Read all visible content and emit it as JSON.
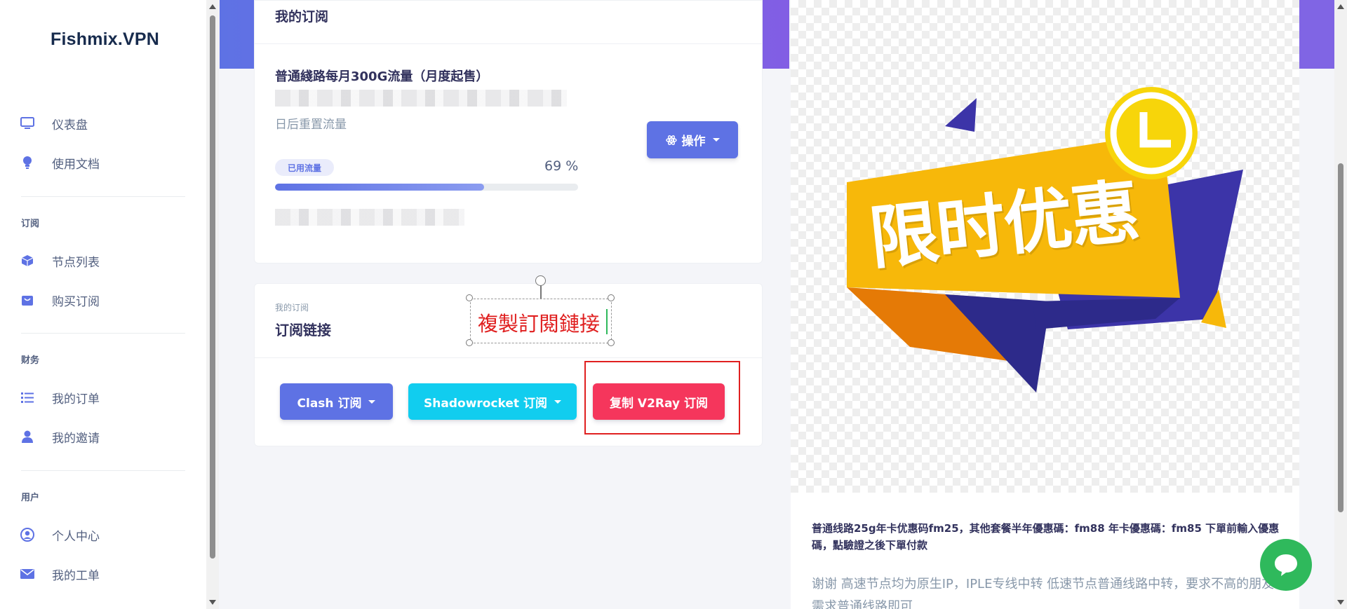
{
  "app": {
    "brand": "Fishmix.VPN"
  },
  "sidebar": {
    "items": [
      {
        "label": "仪表盘",
        "icon": "monitor-icon"
      },
      {
        "label": "使用文档",
        "icon": "lightbulb-icon"
      }
    ],
    "sections": [
      {
        "heading": "订阅",
        "items": [
          {
            "label": "节点列表",
            "icon": "cube-icon"
          },
          {
            "label": "购买订阅",
            "icon": "shopping-bag-icon"
          }
        ]
      },
      {
        "heading": "财务",
        "items": [
          {
            "label": "我的订单",
            "icon": "list-icon"
          },
          {
            "label": "我的邀请",
            "icon": "user-icon"
          }
        ]
      },
      {
        "heading": "用户",
        "items": [
          {
            "label": "个人中心",
            "icon": "user-circle-icon"
          },
          {
            "label": "我的工单",
            "icon": "envelope-icon"
          }
        ]
      }
    ]
  },
  "subscription_card": {
    "title": "我的订阅",
    "plan_name": "普通綫路每月300G流量（月度起售）",
    "reset_note": "日后重置流量",
    "usage_badge": "已用流量",
    "usage_percent_text": "69 %",
    "usage_percent": 0.69,
    "action_button": "操作"
  },
  "link_card": {
    "subtitle": "我的订阅",
    "title": "订阅链接",
    "annotation_text": "複製訂閱鏈接",
    "buttons": {
      "clash": "Clash 订阅",
      "shadowrocket": "Shadowrocket 订阅",
      "v2ray": "复制 V2Ray 订阅"
    }
  },
  "promo": {
    "image_text": "限时优惠",
    "notice_bold": "普通线路25g年卡优惠码fm25，其他套餐半年優惠碼：fm88 年卡優惠碼：fm85 下單前輸入優惠碼，點驗證之後下單付款",
    "notice_body": "谢谢 高速节点均为原生IP，IPLE专线中转 低速节点普通线路中转，要求不高的朋友需求普通线路即可"
  },
  "colors": {
    "primary": "#5e72e4",
    "info": "#11cdef",
    "danger": "#f5365c",
    "chat": "#2fb95c"
  }
}
